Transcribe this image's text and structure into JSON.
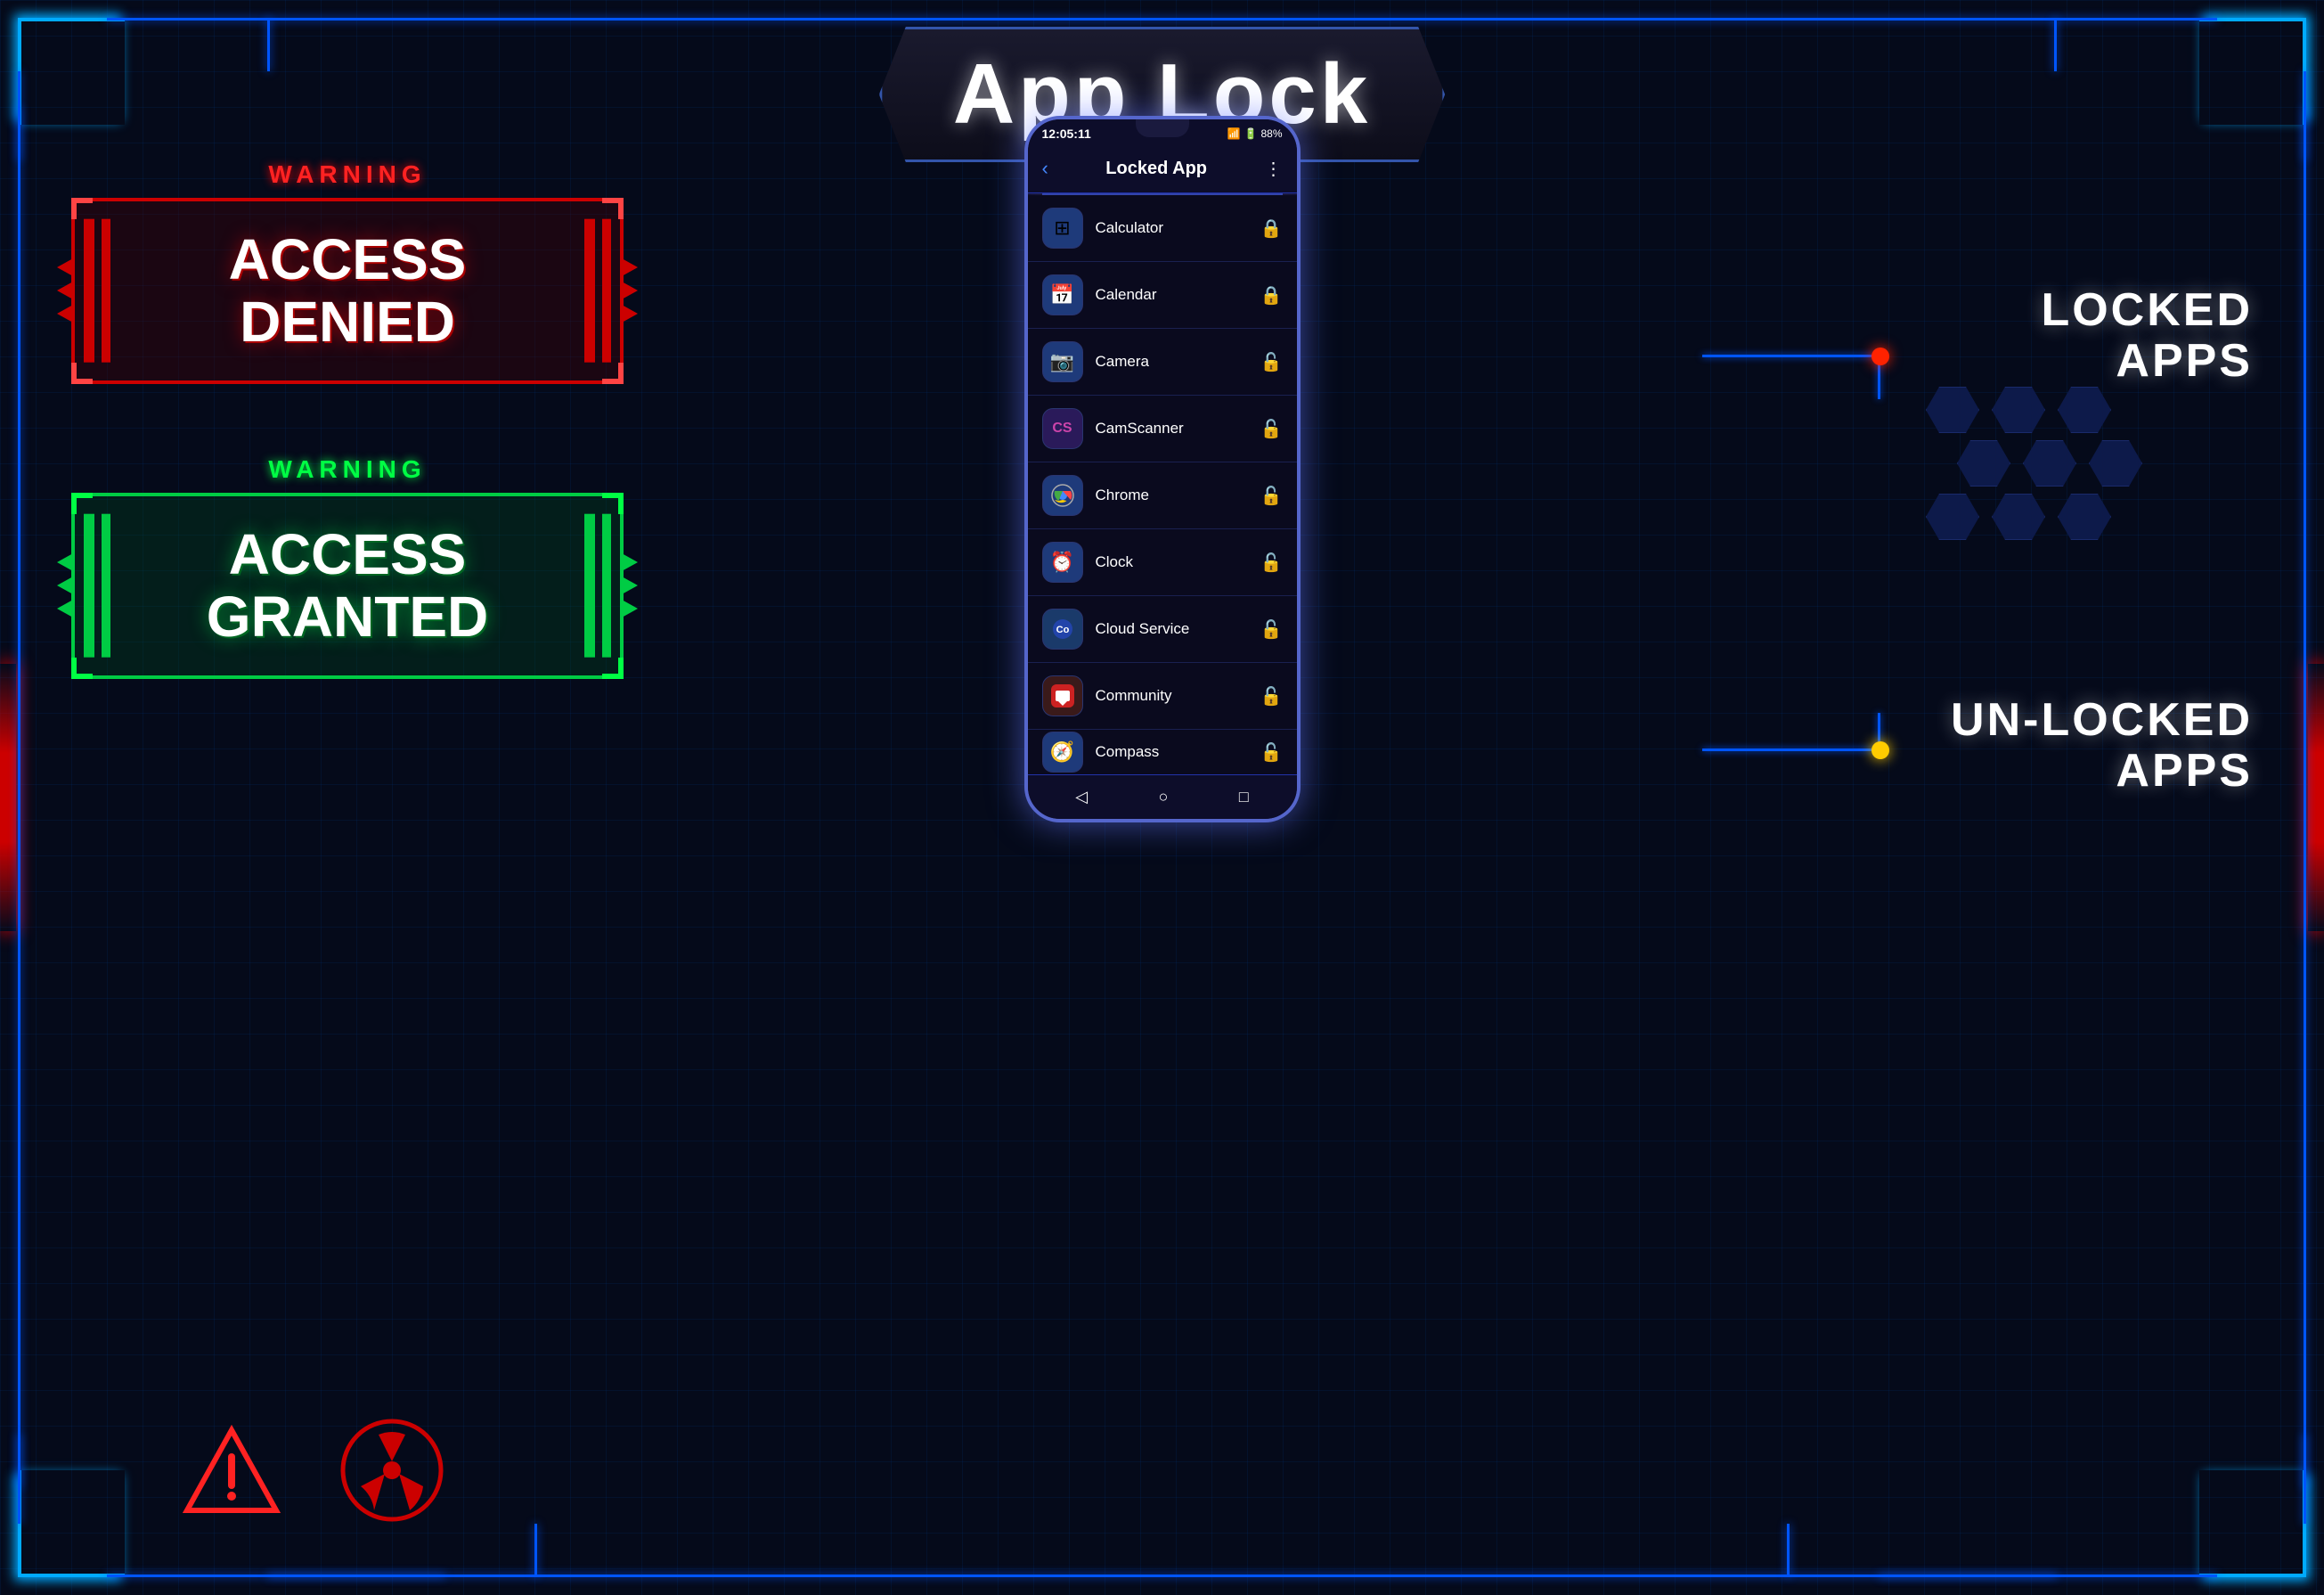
{
  "title": "App Lock",
  "header": {
    "app_name": "Locked App",
    "back_label": "‹",
    "more_label": "⋮"
  },
  "status_bar": {
    "time": "12:05:11",
    "battery": "88%",
    "icons": "📶 🔋"
  },
  "warnings": {
    "denied_label": "WARNING",
    "denied_text": "ACCESS\nDENIED",
    "granted_label": "WARNING",
    "granted_text": "ACCESS\nGRANTED"
  },
  "labels": {
    "locked_apps": "LOCKED\nAPPS",
    "unlocked_apps": "UN-LOCKED\nAPPS"
  },
  "apps": [
    {
      "name": "Calculator",
      "icon": "⊞",
      "locked": true,
      "icon_color": "#1e3a7a"
    },
    {
      "name": "Calendar",
      "icon": "📅",
      "locked": true,
      "icon_color": "#1e3a7a"
    },
    {
      "name": "Camera",
      "icon": "📷",
      "locked": false,
      "icon_color": "#1e3a7a"
    },
    {
      "name": "CamScanner",
      "icon": "CS",
      "locked": false,
      "icon_color": "#2a1a5a"
    },
    {
      "name": "Chrome",
      "icon": "⊙",
      "locked": false,
      "icon_color": "#1e3a7a"
    },
    {
      "name": "Clock",
      "icon": "⏰",
      "locked": false,
      "icon_color": "#1e3a7a"
    },
    {
      "name": "Cloud Service",
      "icon": "Co",
      "locked": false,
      "icon_color": "#1a3a6a"
    },
    {
      "name": "Community",
      "icon": "💬",
      "locked": false,
      "icon_color": "#3a1a1a"
    },
    {
      "name": "Compass",
      "icon": "🧭",
      "locked": false,
      "icon_color": "#1e3a7a"
    }
  ],
  "nav": {
    "back": "◁",
    "home": "○",
    "recent": "□"
  },
  "colors": {
    "accent_blue": "#0055ff",
    "accent_red": "#cc0000",
    "accent_green": "#00cc44",
    "neon_blue": "#00aaff",
    "dot_red": "#ff4400",
    "dot_yellow": "#ffcc00"
  }
}
